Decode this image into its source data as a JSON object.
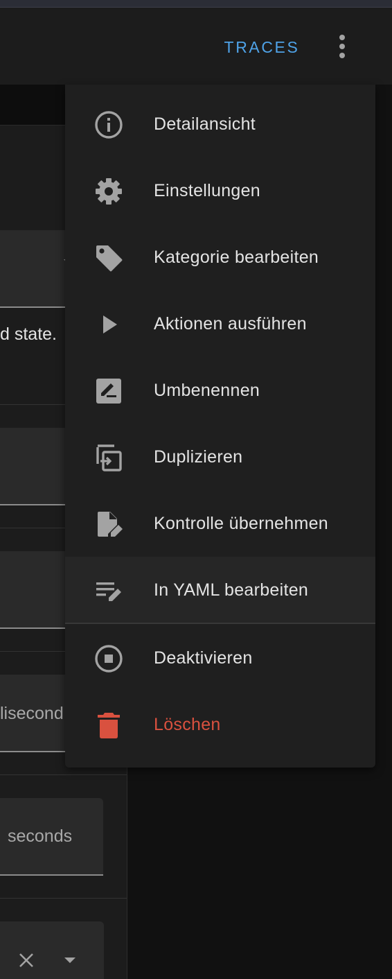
{
  "toolbar": {
    "traces_label": "TRACES",
    "more_icon": "dots-vertical-icon"
  },
  "background": {
    "state_text": "d state.",
    "milliseconds_text": "lisecond",
    "seconds_text": "seconds",
    "clear_icon": "close-icon",
    "dropdown_icon": "menu-down-icon"
  },
  "menu": {
    "items": [
      {
        "label": "Detailansicht",
        "icon": "information-outline-icon"
      },
      {
        "label": "Einstellungen",
        "icon": "cog-icon"
      },
      {
        "label": "Kategorie bearbeiten",
        "icon": "tag-icon"
      },
      {
        "label": "Aktionen ausführen",
        "icon": "play-icon"
      },
      {
        "label": "Umbenennen",
        "icon": "rename-box-icon"
      },
      {
        "label": "Duplizieren",
        "icon": "content-duplicate-icon"
      },
      {
        "label": "Kontrolle übernehmen",
        "icon": "file-edit-icon"
      },
      {
        "label": "In YAML bearbeiten",
        "icon": "text-box-edit-icon"
      },
      {
        "label": "Deaktivieren",
        "icon": "stop-circle-outline-icon"
      },
      {
        "label": "Löschen",
        "icon": "delete-icon"
      }
    ],
    "colors": {
      "icon": "#a3a3a3",
      "danger": "#d9513f",
      "accent": "#4fa3e8"
    }
  }
}
